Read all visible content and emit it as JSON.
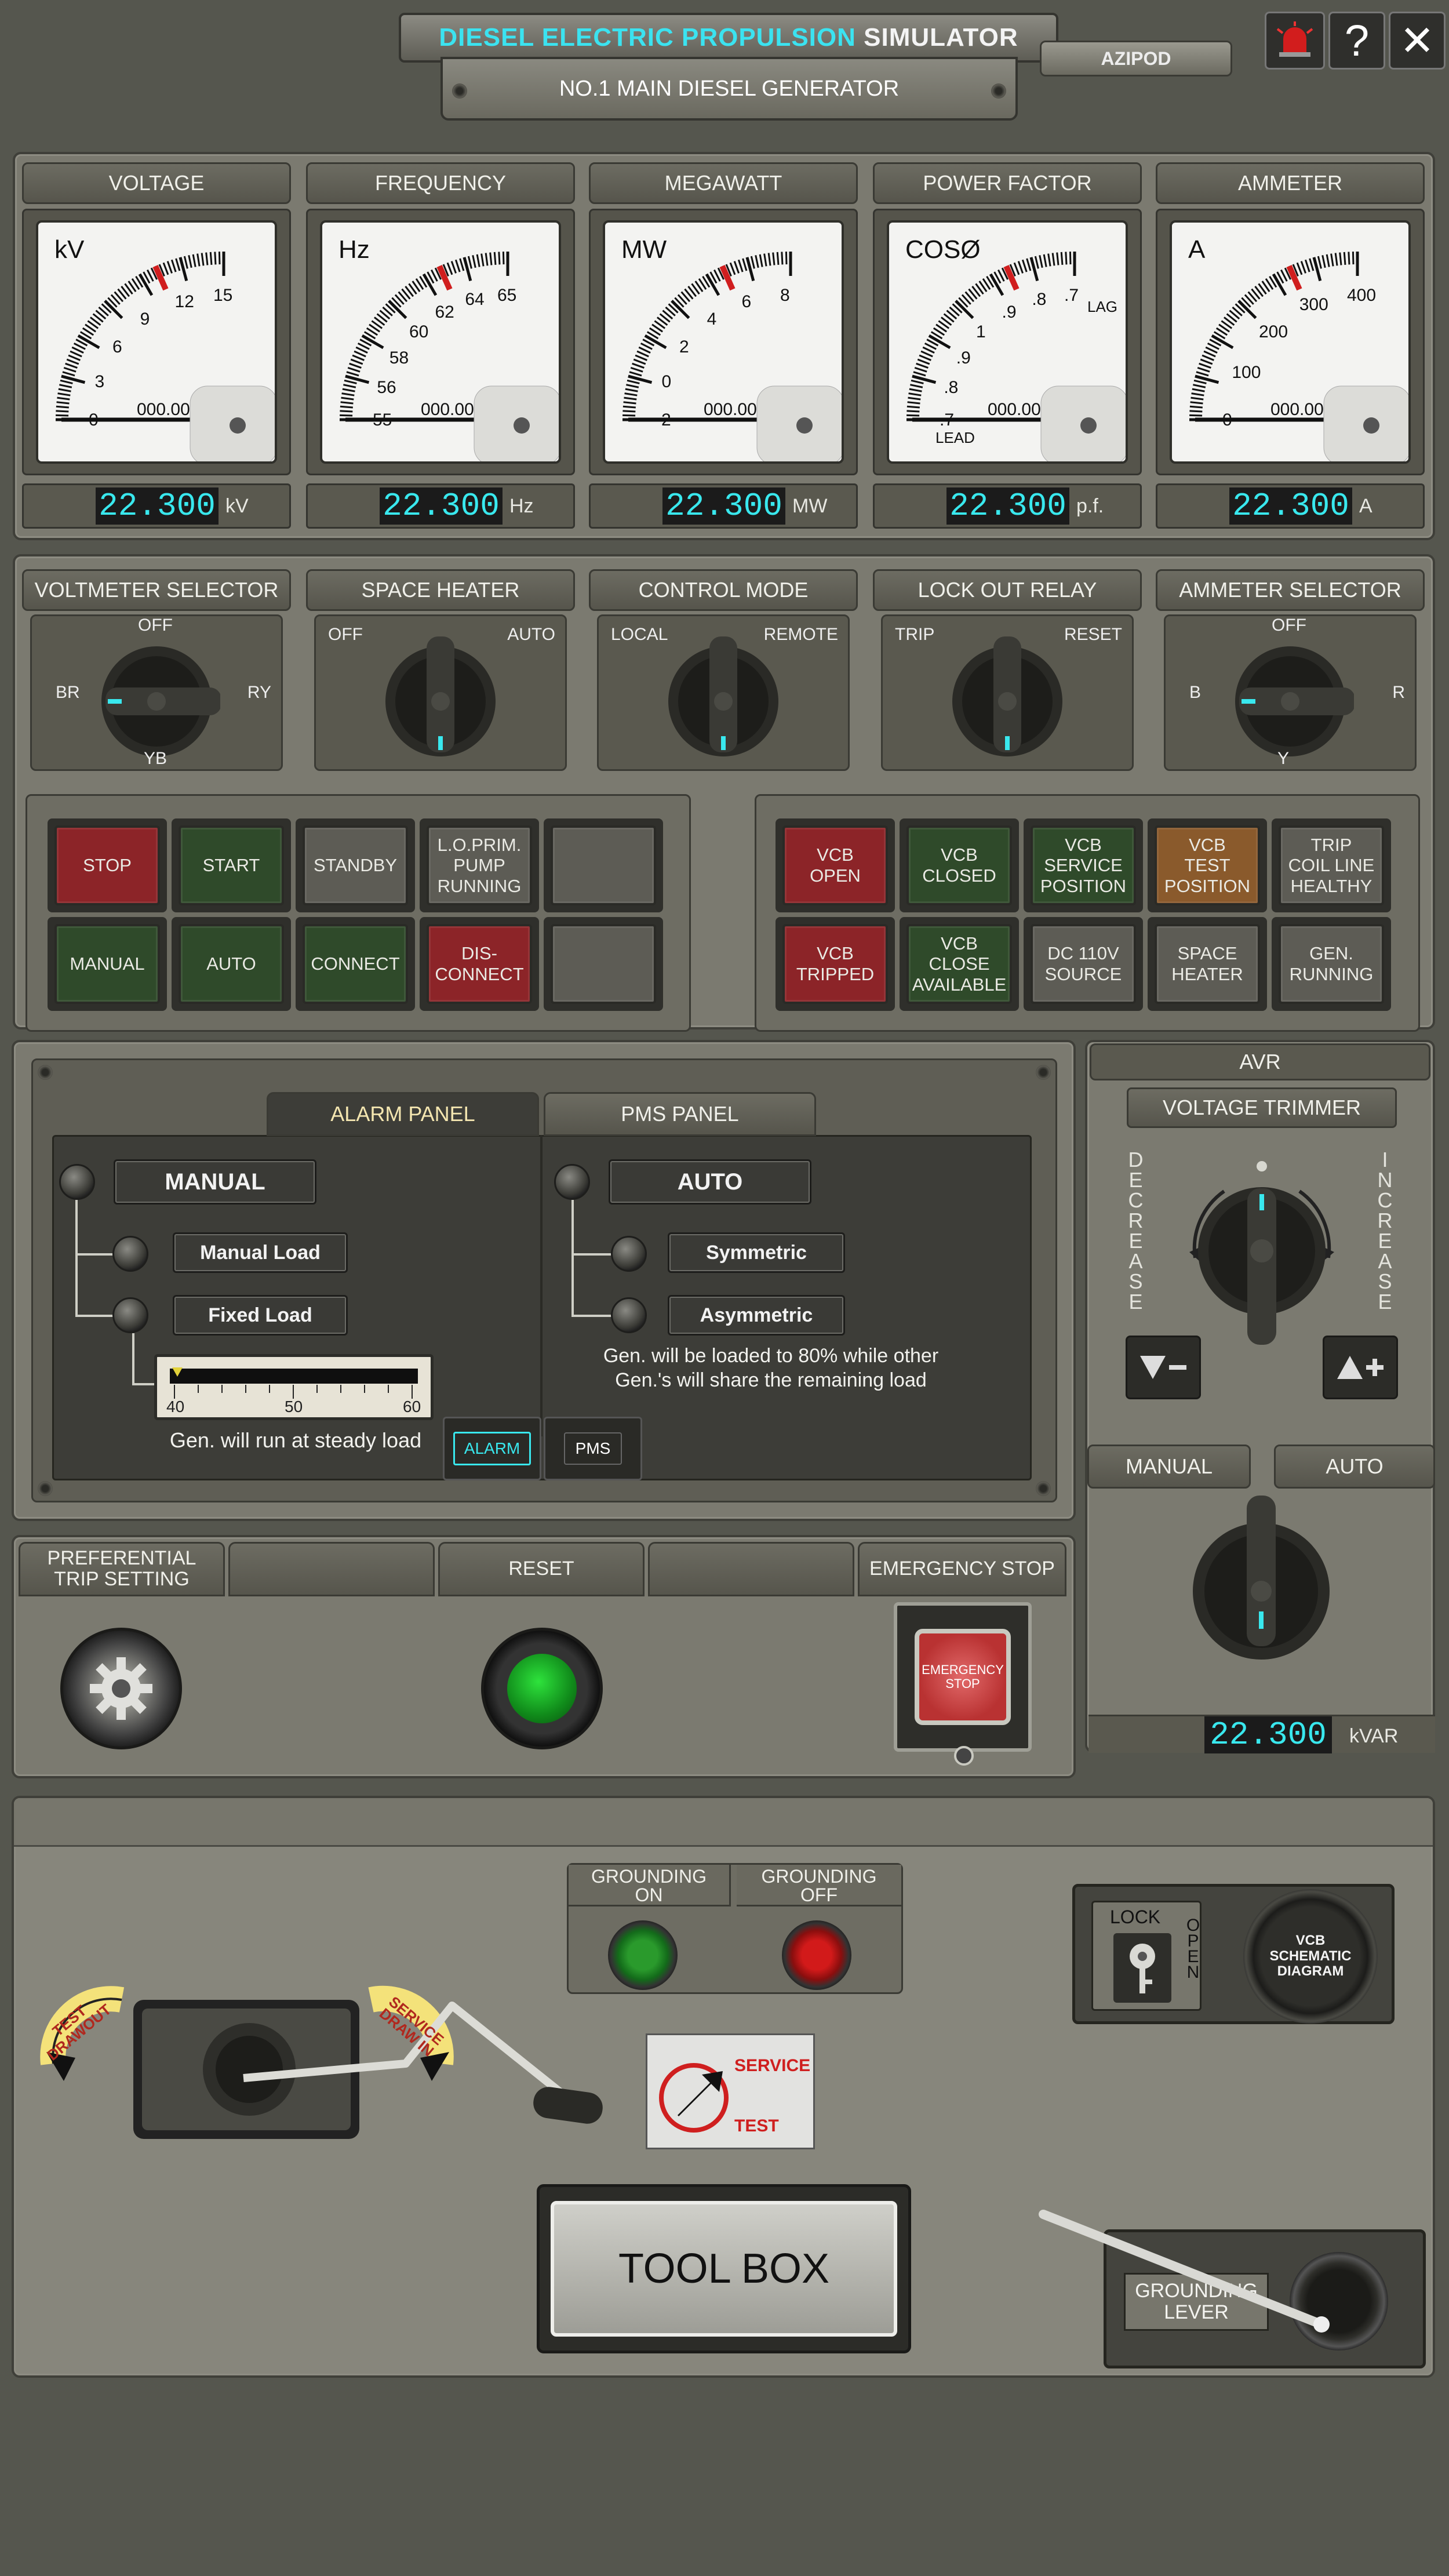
{
  "header": {
    "title_part1": "DIESEL ELECTRIC PROPULSION",
    "title_part2": "SIMULATOR",
    "subtitle": "NO.1 MAIN DIESEL GENERATOR",
    "azipod_button": "AZIPOD",
    "help_label": "?",
    "close_label": "✕"
  },
  "meters": [
    {
      "title": "VOLTAGE",
      "unit_face": "kV",
      "readout": "22.300",
      "unit": "kV",
      "ticks": [
        "0",
        "3",
        "6",
        "9",
        "12",
        "15"
      ],
      "counter": "000.00"
    },
    {
      "title": "FREQUENCY",
      "unit_face": "Hz",
      "readout": "22.300",
      "unit": "Hz",
      "ticks": [
        "55",
        "56",
        "58",
        "60",
        "62",
        "64",
        "65"
      ],
      "counter": "000.00"
    },
    {
      "title": "MEGAWATT",
      "unit_face": "MW",
      "readout": "22.300",
      "unit": "MW",
      "ticks": [
        "-2",
        "0",
        "2",
        "4",
        "6",
        "8"
      ],
      "counter": "000.00"
    },
    {
      "title": "POWER FACTOR",
      "unit_face": "COSØ",
      "readout": "22.300",
      "unit": "p.f.",
      "ticks": [
        ".7",
        ".8",
        ".9",
        "1",
        ".9",
        ".8",
        ".7"
      ],
      "counter": "000.00",
      "lead": "LEAD",
      "lag": "LAG"
    },
    {
      "title": "AMMETER",
      "unit_face": "A",
      "readout": "22.300",
      "unit": "A",
      "ticks": [
        "0",
        "100",
        "200",
        "300",
        "400"
      ],
      "counter": "000.00"
    }
  ],
  "selectors": [
    {
      "title": "VOLTMETER SELECTOR",
      "labels": {
        "top": "OFF",
        "left": "BR",
        "right": "RY",
        "bottom": "YB"
      }
    },
    {
      "title": "SPACE HEATER",
      "labels": {
        "left": "OFF",
        "right": "AUTO"
      }
    },
    {
      "title": "CONTROL MODE",
      "labels": {
        "left": "LOCAL",
        "right": "REMOTE"
      }
    },
    {
      "title": "LOCK OUT RELAY",
      "labels": {
        "left": "TRIP",
        "right": "RESET"
      }
    },
    {
      "title": "AMMETER SELECTOR",
      "labels": {
        "top": "OFF",
        "left": "B",
        "right": "R",
        "bottom": "Y"
      }
    }
  ],
  "left_indicators": [
    {
      "label": "STOP",
      "color": "red"
    },
    {
      "label": "START",
      "color": "green"
    },
    {
      "label": "STANDBY",
      "color": "grey"
    },
    {
      "label": "L.O.PRIM.\nPUMP\nRUNNING",
      "color": "grey"
    },
    {
      "label": "",
      "color": "grey"
    },
    {
      "label": "MANUAL",
      "color": "green"
    },
    {
      "label": "AUTO",
      "color": "green"
    },
    {
      "label": "CONNECT",
      "color": "green"
    },
    {
      "label": "DIS-\nCONNECT",
      "color": "red"
    },
    {
      "label": "",
      "color": "grey"
    }
  ],
  "right_indicators": [
    {
      "label": "VCB\nOPEN",
      "color": "red"
    },
    {
      "label": "VCB\nCLOSED",
      "color": "green"
    },
    {
      "label": "VCB\nSERVICE\nPOSITION",
      "color": "green"
    },
    {
      "label": "VCB\nTEST\nPOSITION",
      "color": "orange"
    },
    {
      "label": "TRIP\nCOIL LINE\nHEALTHY",
      "color": "grey"
    },
    {
      "label": "VCB\nTRIPPED",
      "color": "red"
    },
    {
      "label": "VCB\nCLOSE\nAVAILABLE",
      "color": "green"
    },
    {
      "label": "DC 110V\nSOURCE",
      "color": "grey"
    },
    {
      "label": "SPACE\nHEATER",
      "color": "grey"
    },
    {
      "label": "GEN.\nRUNNING",
      "color": "grey"
    }
  ],
  "pms": {
    "tabs": [
      "ALARM PANEL",
      "PMS PANEL"
    ],
    "manual": "MANUAL",
    "auto": "AUTO",
    "manual_load": "Manual Load",
    "fixed_load": "Fixed Load",
    "symmetric": "Symmetric",
    "asymmetric": "Asymmetric",
    "scale": [
      "40",
      "50",
      "60"
    ],
    "steady_note": "Gen. will run at steady load",
    "auto_note_1": "Gen. will be loaded to 80% while other",
    "auto_note_2": "Gen.'s will share the remaining load",
    "alarm_btn": "ALARM",
    "pms_btn": "PMS"
  },
  "avr": {
    "title": "AVR",
    "trimmer": "VOLTAGE TRIMMER",
    "decrease": "DECREASE",
    "increase": "INCREASE",
    "manual": "MANUAL",
    "auto": "AUTO",
    "readout": "22.300",
    "unit": "kVAR"
  },
  "bottom_controls": {
    "tabs": [
      "PREFERENTIAL\nTRIP SETTING",
      "",
      "RESET",
      "",
      "EMERGENCY STOP"
    ],
    "emergency_label": "EMERGENCY\nSTOP"
  },
  "breaker": {
    "grounding_on": "GROUNDING\nON",
    "grounding_off": "GROUNDING\nOFF",
    "lock": "LOCK",
    "open": "OPEN",
    "vcb_diagram": "VCB\nSCHEMATIC\nDIAGRAM",
    "test_drawout": "TEST\nDRAWOUT",
    "service_drawin": "SERVICE\nDRAW IN",
    "service": "SERVICE",
    "test": "TEST",
    "toolbox": "TOOL BOX",
    "grounding_lever": "GROUNDING\nLEVER"
  },
  "colors": {
    "accent_cyan": "#39e8ee",
    "panel": "#7b7a70",
    "alarm_red": "#8c2428",
    "ok_green": "#2f4a2a"
  }
}
